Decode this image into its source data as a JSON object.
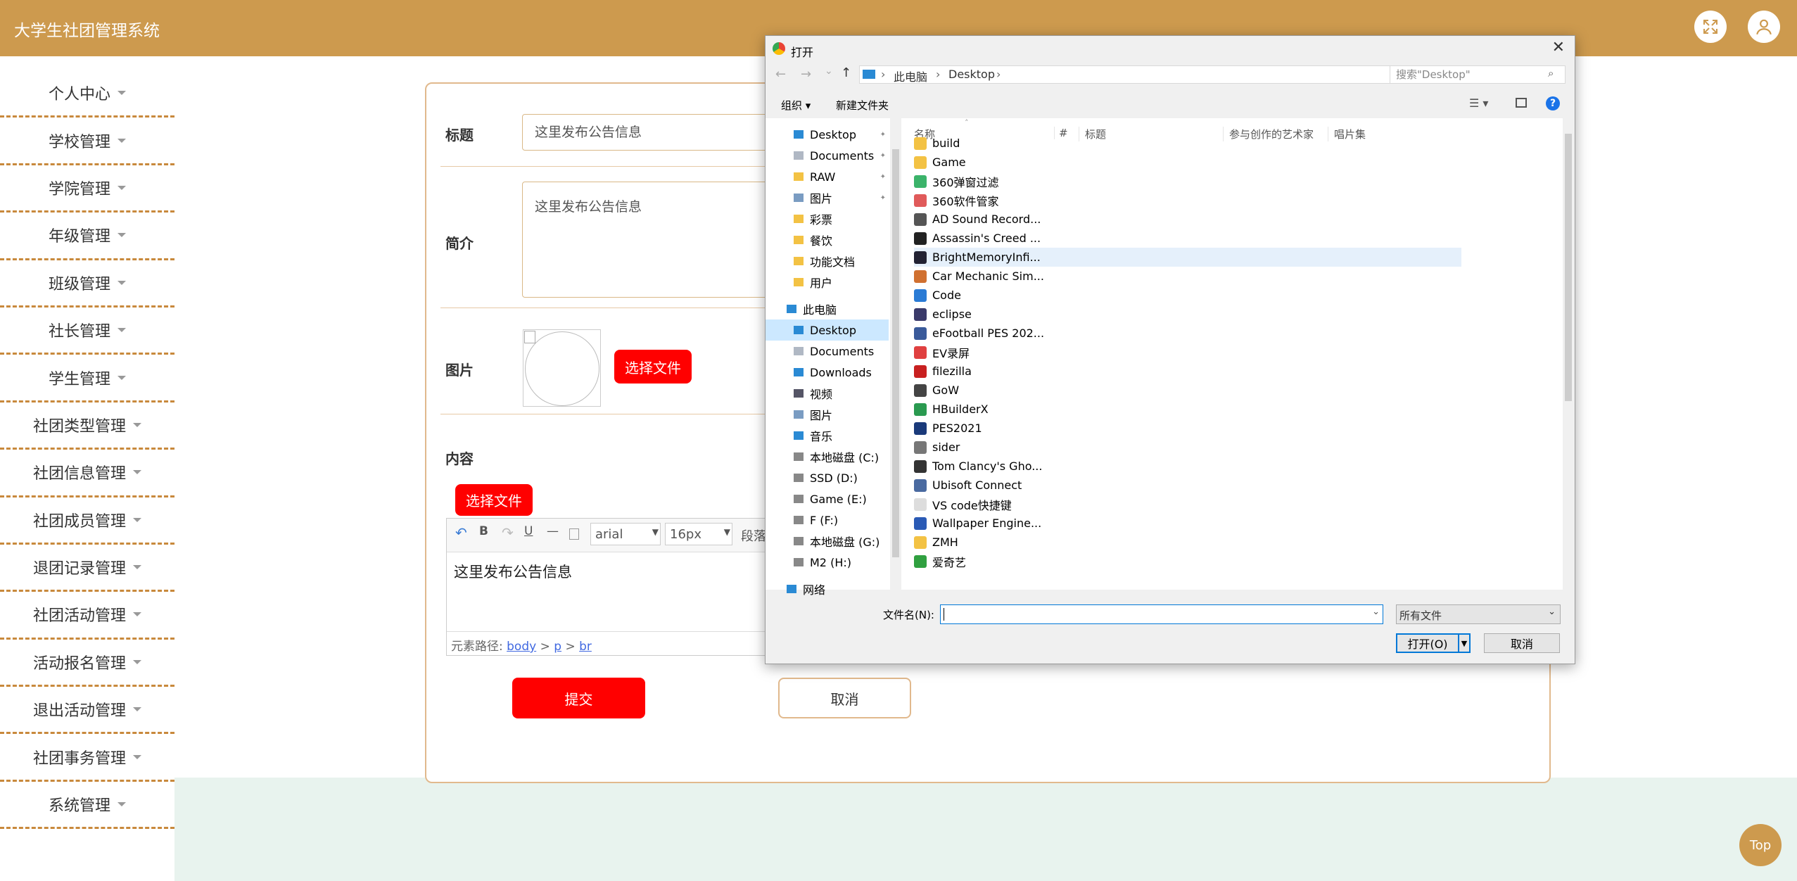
{
  "header": {
    "title": "大学生社团管理系统"
  },
  "sidebar": {
    "items": [
      "个人中心",
      "学校管理",
      "学院管理",
      "年级管理",
      "班级管理",
      "社长管理",
      "学生管理",
      "社团类型管理",
      "社团信息管理",
      "社团成员管理",
      "退团记录管理",
      "社团活动管理",
      "活动报名管理",
      "退出活动管理",
      "社团事务管理",
      "系统管理"
    ]
  },
  "form": {
    "title_label": "标题",
    "title_value": "这里发布公告信息",
    "intro_label": "简介",
    "intro_value": "这里发布公告信息",
    "image_label": "图片",
    "choose_file": "选择文件",
    "content_label": "内容",
    "content_choose_file": "选择文件",
    "editor": {
      "font": "arial",
      "size": "16px",
      "paragraph": "段落",
      "body_text": "这里发布公告信息",
      "path_label": "元素路径:",
      "path_body": "body",
      "path_sep1": ">",
      "path_p": "p",
      "path_sep2": ">",
      "path_br": "br"
    },
    "submit": "提交",
    "cancel": "取消"
  },
  "top_button": "Top",
  "dialog": {
    "title": "打开",
    "breadcrumb": [
      "此电脑",
      "Desktop"
    ],
    "search_placeholder": "搜索\"Desktop\"",
    "toolbar": {
      "organize": "组织",
      "new_folder": "新建文件夹"
    },
    "nav_items": [
      {
        "label": "Desktop",
        "icon": "desktop-icon"
      },
      {
        "label": "Documents",
        "icon": "documents-icon"
      },
      {
        "label": "RAW",
        "icon": "folder-icon"
      },
      {
        "label": "图片",
        "icon": "pictures-icon"
      },
      {
        "label": "彩票",
        "icon": "folder-icon"
      },
      {
        "label": "餐饮",
        "icon": "folder-icon"
      },
      {
        "label": "功能文档",
        "icon": "folder-icon"
      },
      {
        "label": "用户",
        "icon": "folder-icon"
      },
      {
        "label": "此电脑",
        "icon": "computer-icon"
      },
      {
        "label": "Desktop",
        "icon": "desktop-icon"
      },
      {
        "label": "Documents",
        "icon": "documents-icon"
      },
      {
        "label": "Downloads",
        "icon": "downloads-icon"
      },
      {
        "label": "视频",
        "icon": "video-icon"
      },
      {
        "label": "图片",
        "icon": "pictures-icon"
      },
      {
        "label": "音乐",
        "icon": "music-icon"
      },
      {
        "label": "本地磁盘 (C:)",
        "icon": "drive-icon"
      },
      {
        "label": "SSD (D:)",
        "icon": "drive-icon"
      },
      {
        "label": "Game (E:)",
        "icon": "drive-icon"
      },
      {
        "label": "F (F:)",
        "icon": "drive-icon"
      },
      {
        "label": "本地磁盘 (G:)",
        "icon": "drive-icon"
      },
      {
        "label": "M2 (H:)",
        "icon": "drive-icon"
      },
      {
        "label": "网络",
        "icon": "network-icon"
      }
    ],
    "columns": [
      "名称",
      "#",
      "标题",
      "参与创作的艺术家",
      "唱片集"
    ],
    "files": [
      "build",
      "Game",
      "360弹窗过滤",
      "360软件管家",
      "AD Sound Record...",
      "Assassin's Creed ...",
      "BrightMemoryInfi...",
      "Car Mechanic Sim...",
      "Code",
      "eclipse",
      "eFootball PES 202...",
      "EV录屏",
      "filezilla",
      "GoW",
      "HBuilderX",
      "PES2021",
      "sider",
      "Tom Clancy's Gho...",
      "Ubisoft Connect",
      "VS code快捷键",
      "Wallpaper Engine...",
      "ZMH",
      "爱奇艺"
    ],
    "selected_file": "BrightMemoryInfi...",
    "filename_label": "文件名(N):",
    "filename_value": "",
    "filetype": "所有文件",
    "open_button": "打开(O)",
    "cancel_button": "取消"
  },
  "colors": {
    "header": "#cd9a4e",
    "accent_red": "#ff0000",
    "border_tan": "#e1b98d",
    "bottom_band": "#e8f3ee",
    "selection": "#e5f0fb"
  }
}
